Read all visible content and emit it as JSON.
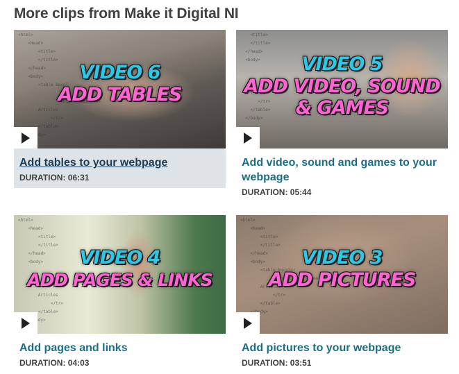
{
  "section_title": "More clips from Make it Digital NI",
  "clips": [
    {
      "overlay": [
        "VIDEO 6",
        "ADD TABLES",
        ""
      ],
      "code": "<html>\n    <head>\n        <title>\n        </title>\n    </head>\n    <body>\n        <table bgcol\n\n                 \"html\">home</td>\n        Articles\n             </tr>\n        </table>\n    </body>",
      "title": "Add tables to your webpage",
      "duration": "DURATION: 06:31",
      "active": true
    },
    {
      "overlay": [
        "VIDEO 5",
        "ADD VIDEO, SOUND",
        "& GAMES"
      ],
      "code": "    <title>\n    </title>\n  </head>\n  <body>\n\n\n\n  Articles\n       </tr>\n    </table>\n  </body>",
      "title": "Add video, sound and games to your webpage",
      "duration": "DURATION: 05:44",
      "active": false
    },
    {
      "overlay": [
        "VIDEO 4",
        "ADD PAGES & LINKS",
        ""
      ],
      "code": "<html>\n    <head>\n        <title>\n        </title>\n    </head>\n    <body>\n\n\n\n        Articles\n             </tr>\n        </table>\n    </body>",
      "title": "Add pages and links",
      "duration": "DURATION: 04:03",
      "active": false
    },
    {
      "overlay": [
        "VIDEO 3",
        "ADD PICTURES",
        ""
      ],
      "code": "<html>\n    <head>\n        <title>\n        </title>\n    </head>\n    <body>\n        <table bgcolor\n              \"index.html\">home</td>\n        Articles\n             </tr>\n        </table>\n    </body>",
      "title": "Add pictures to your webpage",
      "duration": "DURATION: 03:51",
      "active": false
    }
  ],
  "colors": {
    "link": "#1b6e85",
    "active_bg": "#dde3e6",
    "overlay_pink": "#ff64d2",
    "overlay_cyan": "#2cc8e6"
  },
  "icons": {
    "play": "play-icon"
  }
}
